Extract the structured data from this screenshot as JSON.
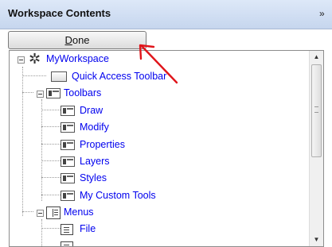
{
  "panel": {
    "title": "Workspace Contents",
    "collapse_glyph": "»"
  },
  "done_button": {
    "mnemonic": "D",
    "rest": "one"
  },
  "tree": {
    "root": {
      "label": "MyWorkspace",
      "icon": "gear-icon"
    },
    "quick_access": {
      "label": "Quick Access Toolbar",
      "icon": "quick-access-toolbar-icon"
    },
    "toolbars": {
      "label": "Toolbars",
      "icon": "toolbars-icon",
      "items": [
        "Draw",
        "Modify",
        "Properties",
        "Layers",
        "Styles",
        "My Custom Tools"
      ]
    },
    "menus": {
      "label": "Menus",
      "icon": "menus-icon",
      "items": [
        "File"
      ]
    }
  },
  "colors": {
    "link_text": "#0000ee",
    "annotation_arrow": "#e0151b",
    "header_bg": "#c6d6ee"
  }
}
